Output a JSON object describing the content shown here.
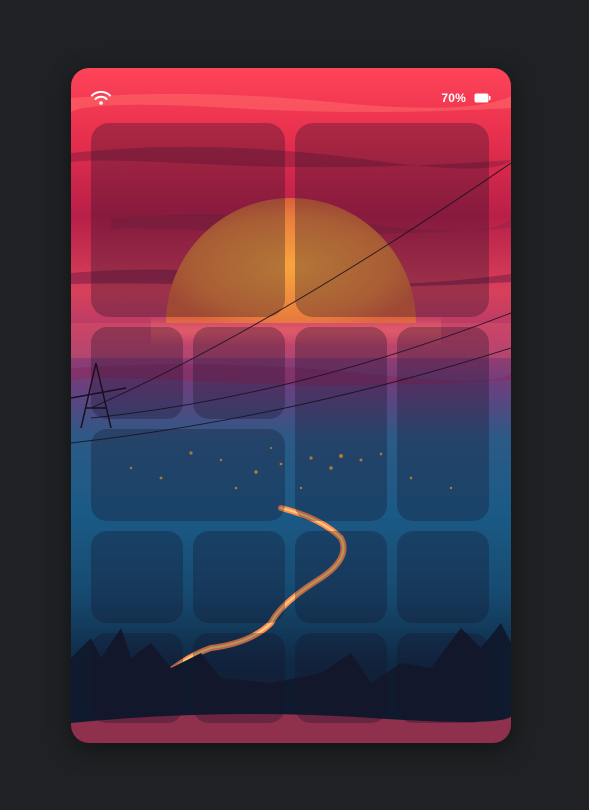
{
  "status_bar": {
    "battery_percent": "70%",
    "wifi_icon": "wifi-icon",
    "battery_icon": "battery-icon"
  },
  "wallpaper": {
    "description_icon": "sunset-wallpaper",
    "colors": {
      "sky_top": "#ff3a55",
      "sky_mid": "#c22550",
      "sun": "#e8873a",
      "horizon": "#9a3a78",
      "valley": "#1d5b85",
      "ground": "#0e2338",
      "road": "#ff7a5a"
    }
  },
  "widget_tiles": [
    {
      "id": "widget-large-1"
    },
    {
      "id": "widget-large-2"
    },
    {
      "id": "app-tile-1"
    },
    {
      "id": "app-tile-2"
    },
    {
      "id": "widget-tall-1"
    },
    {
      "id": "widget-tall-2"
    },
    {
      "id": "widget-wide-1"
    },
    {
      "id": "app-tile-3"
    },
    {
      "id": "app-tile-4"
    },
    {
      "id": "app-tile-5"
    },
    {
      "id": "app-tile-6"
    },
    {
      "id": "app-tile-7"
    },
    {
      "id": "app-tile-8"
    },
    {
      "id": "app-tile-9"
    },
    {
      "id": "app-tile-10"
    }
  ]
}
